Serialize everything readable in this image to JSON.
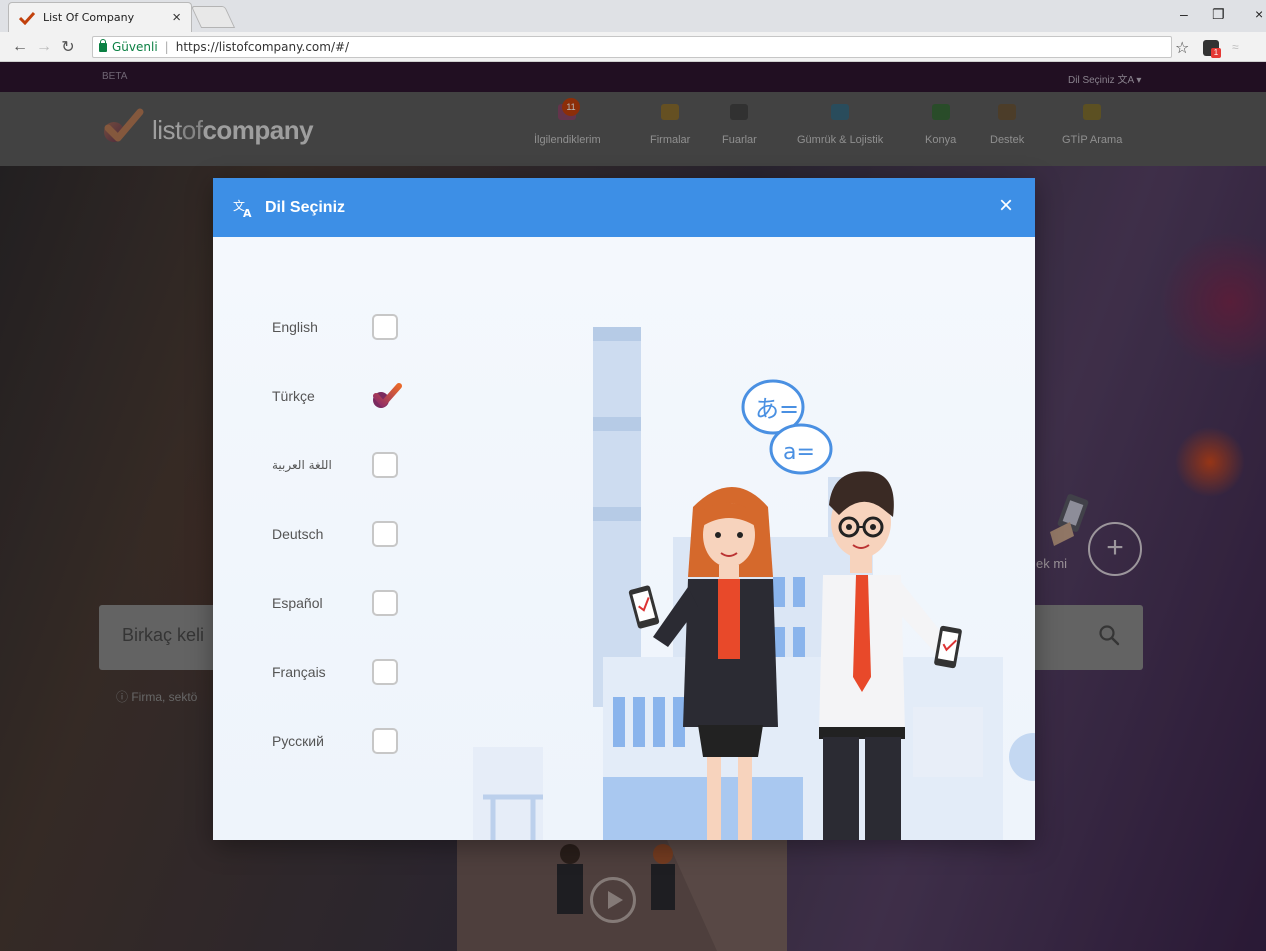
{
  "browser": {
    "tab_title": "List Of Company",
    "tab_close": "×",
    "secure_label": "Güvenli",
    "url": "https://listofcompany.com/#/",
    "extension_badge": "1"
  },
  "site": {
    "beta": "BETA",
    "language_picker": "Dil Seçiniz",
    "logo_prefix": "list",
    "logo_of": "of",
    "logo_suffix": "company",
    "nav": [
      {
        "label": "İlgilendiklerim",
        "badge": "11",
        "color": "#9b3a6a"
      },
      {
        "label": "Firmalar",
        "color": "#a3822a"
      },
      {
        "label": "Fuarlar",
        "color": "#3a3a3a"
      },
      {
        "label": "Gümrük & Lojistik",
        "color": "#2f6f8a"
      },
      {
        "label": "Konya",
        "color": "#3b7a3b"
      },
      {
        "label": "Destek",
        "color": "#7a5a3a"
      },
      {
        "label": "GTİP Arama",
        "color": "#8a7a2a"
      }
    ],
    "search_placeholder": "Birkaç keli",
    "search_hint": "ⓘ Firma, sektö",
    "side_text": "ek mi",
    "plus": "+"
  },
  "modal": {
    "title": "Dil Seçiniz",
    "close": "×",
    "languages": [
      {
        "label": "English",
        "selected": false
      },
      {
        "label": "Türkçe",
        "selected": true
      },
      {
        "label": "اللغة العربية",
        "selected": false
      },
      {
        "label": "Deutsch",
        "selected": false
      },
      {
        "label": "Español",
        "selected": false
      },
      {
        "label": "Français",
        "selected": false
      },
      {
        "label": "Русский",
        "selected": false
      }
    ],
    "bubble_top": "あ=",
    "bubble_bottom": "a="
  },
  "colors": {
    "modal_header": "#3d8fe6",
    "brand_check_start": "#e8682a",
    "brand_check_end": "#8c2a6a",
    "tie": "#e8492a",
    "jacket": "#2b2b33",
    "hair_woman": "#d5692c"
  }
}
